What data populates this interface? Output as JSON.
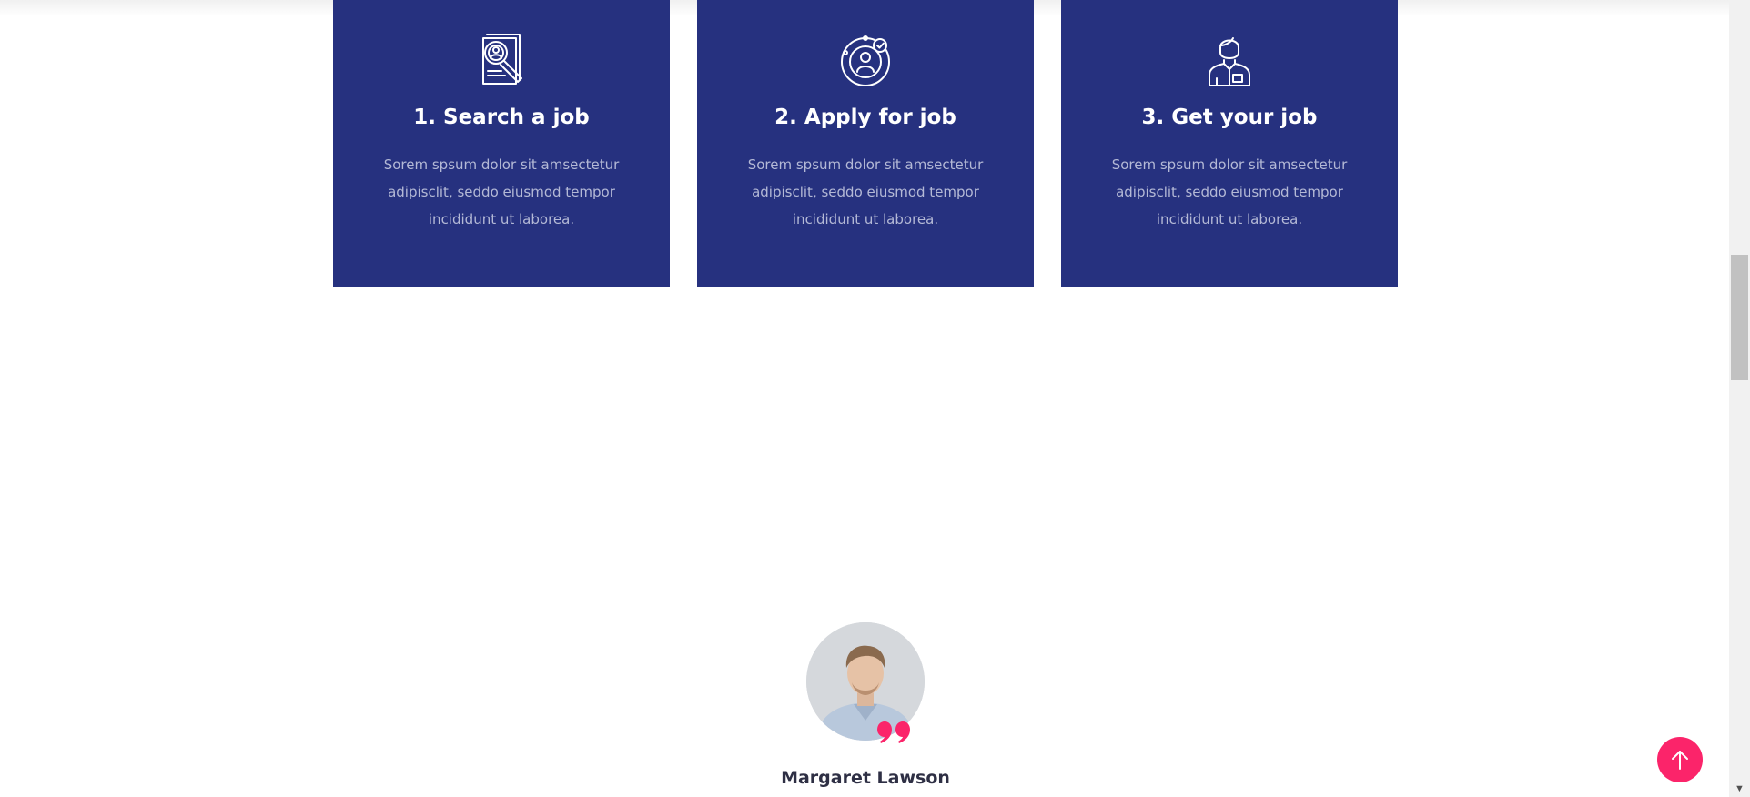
{
  "steps": [
    {
      "icon": "search-resume-icon",
      "title": "1. Search a job",
      "text": "Sorem spsum dolor sit amsectetur adipisclit, seddo eiusmod tempor incididunt ut laborea."
    },
    {
      "icon": "apply-candidate-icon",
      "title": "2. Apply for job",
      "text": "Sorem spsum dolor sit amsectetur adipisclit, seddo eiusmod tempor incididunt ut laborea."
    },
    {
      "icon": "employee-icon",
      "title": "3. Get your job",
      "text": "Sorem spsum dolor sit amsectetur adipisclit, seddo eiusmod tempor incididunt ut laborea."
    }
  ],
  "testimonial": {
    "name": "Margaret Lawson",
    "quote_icon": "quote-icon"
  },
  "back_to_top": {
    "icon": "arrow-up-icon"
  },
  "colors": {
    "card_bg": "#26317f",
    "card_text_muted": "#b4b9d6",
    "accent": "#fb246a",
    "name_text": "#2e2f44"
  }
}
